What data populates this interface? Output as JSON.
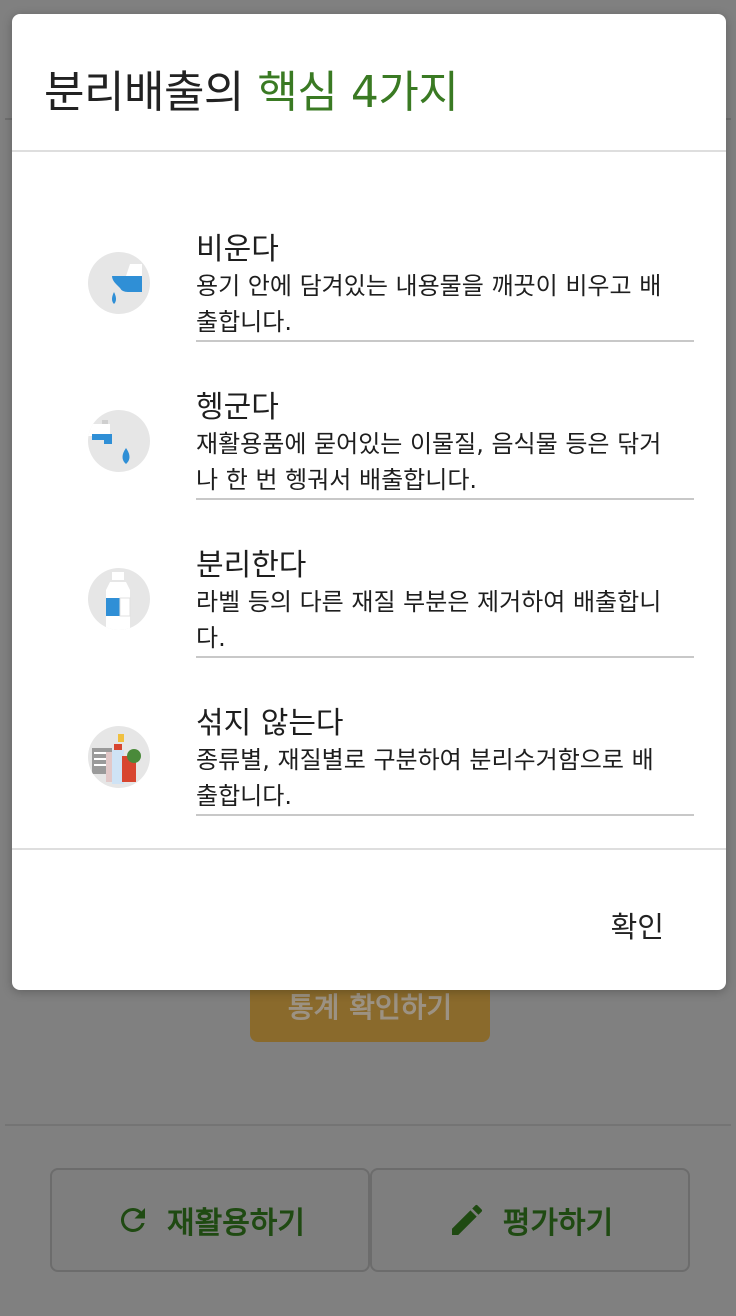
{
  "background": {
    "stats_button": "통계 확인하기",
    "recycle_button": "재활용하기",
    "rate_button": "평가하기"
  },
  "dialog": {
    "title_main": "분리배출의",
    "title_accent": "핵심 4가지",
    "items": [
      {
        "heading": "비운다",
        "desc": "용기 안에 담겨있는 내용물을 깨끗이 비우고 배출합니다.",
        "icon": "pour-icon"
      },
      {
        "heading": "헹군다",
        "desc": "재활용품에 묻어있는 이물질, 음식물 등은 닦거나 한 번 헹궈서 배출합니다.",
        "icon": "faucet-icon"
      },
      {
        "heading": "분리한다",
        "desc": "라벨 등의 다른 재질 부분은 제거하여 배출합니다.",
        "icon": "bottle-icon"
      },
      {
        "heading": "섞지 않는다",
        "desc": "종류별, 재질별로 구분하여 분리수거함으로 배출합니다.",
        "icon": "sorted-waste-icon"
      }
    ],
    "confirm_label": "확인"
  },
  "colors": {
    "accent": "#3a7a23",
    "overlay": "#808080",
    "icon_blue": "#2f8fd6"
  }
}
